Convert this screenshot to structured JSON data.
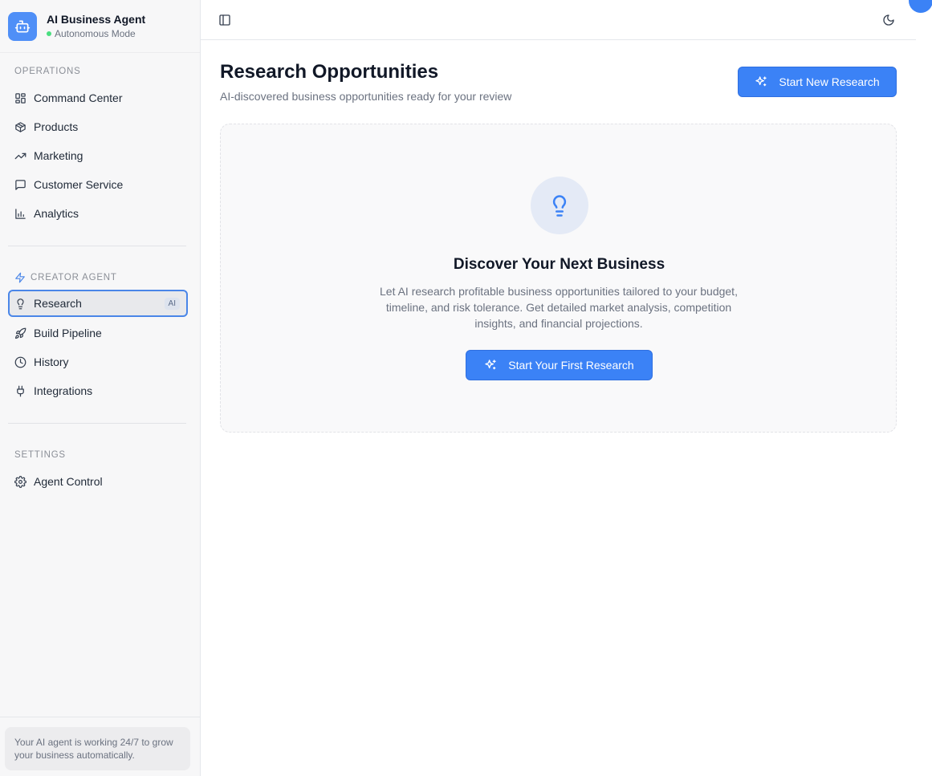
{
  "brand": {
    "title": "AI Business Agent",
    "subtitle": "Autonomous Mode"
  },
  "sections": {
    "operations": "OPERATIONS",
    "creator": "CREATOR AGENT",
    "settings": "SETTINGS"
  },
  "nav": {
    "command_center": "Command Center",
    "products": "Products",
    "marketing": "Marketing",
    "customer_service": "Customer Service",
    "analytics": "Analytics",
    "research": "Research",
    "research_badge": "AI",
    "build_pipeline": "Build Pipeline",
    "history": "History",
    "integrations": "Integrations",
    "agent_control": "Agent Control"
  },
  "footer": {
    "text": "Your AI agent is working 24/7 to grow your business automatically."
  },
  "page": {
    "title": "Research Opportunities",
    "subtitle": "AI-discovered business opportunities ready for your review",
    "new_research_button": "Start New Research"
  },
  "empty_state": {
    "title": "Discover Your Next Business",
    "description": "Let AI research profitable business opportunities tailored to your budget, timeline, and risk tolerance. Get detailed market analysis, competition insights, and financial projections.",
    "button": "Start Your First Research"
  },
  "colors": {
    "accent": "#3b82f6",
    "active_border": "#4a86e8",
    "status_online": "#4ade80"
  }
}
